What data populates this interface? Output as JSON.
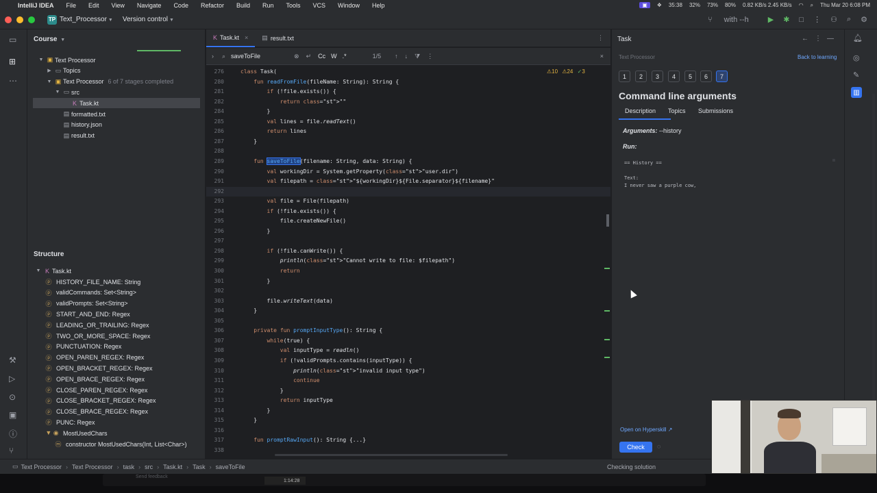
{
  "menubar": {
    "app": "IntelliJ IDEA",
    "items": [
      "File",
      "Edit",
      "View",
      "Navigate",
      "Code",
      "Refactor",
      "Build",
      "Run",
      "Tools",
      "VCS",
      "Window",
      "Help"
    ],
    "tray": [
      "35:38",
      "32%",
      "73%",
      "80%",
      "0.82 KB/s 2.45 KB/s"
    ],
    "datetime": "Thu Mar 20  6:08 PM"
  },
  "titlebar": {
    "project_badge": "TP",
    "project": "Text_Processor",
    "vcs": "Version control",
    "run_config": "with --h"
  },
  "course": {
    "title": "Course",
    "tree": [
      {
        "label": "Text Processor",
        "indent": 0,
        "icon": "course"
      },
      {
        "label": "Topics",
        "indent": 1,
        "icon": "folder"
      },
      {
        "label": "Text Processor",
        "indent": 1,
        "icon": "lesson",
        "extra": "6 of 7 stages completed"
      },
      {
        "label": "src",
        "indent": 2,
        "icon": "folder"
      },
      {
        "label": "Task.kt",
        "indent": 3,
        "icon": "kotlin",
        "selected": true
      },
      {
        "label": "formatted.txt",
        "indent": 2,
        "icon": "file"
      },
      {
        "label": "history.json",
        "indent": 2,
        "icon": "file"
      },
      {
        "label": "result.txt",
        "indent": 2,
        "icon": "file"
      }
    ]
  },
  "structure": {
    "title": "Structure",
    "root": "Task.kt",
    "items": [
      "HISTORY_FILE_NAME: String",
      "validCommands: Set<String>",
      "validPrompts: Set<String>",
      "START_AND_END: Regex",
      "LEADING_OR_TRAILING: Regex",
      "TWO_OR_MORE_SPACE: Regex",
      "PUNCTUATION: Regex",
      "OPEN_PAREN_REGEX: Regex",
      "OPEN_BRACKET_REGEX: Regex",
      "OPEN_BRACE_REGEX: Regex",
      "CLOSE_PAREN_REGEX: Regex",
      "CLOSE_BRACKET_REGEX: Regex",
      "CLOSE_BRACE_REGEX: Regex",
      "PUNC: Regex",
      "MostUsedChars",
      "constructor MostUsedChars(Int, List<Char>)"
    ]
  },
  "editor": {
    "tabs": [
      "Task.kt",
      "result.txt"
    ],
    "find": {
      "query": "saveToFile",
      "cc": "Cc",
      "w": "W",
      "regex": ".*",
      "count": "1/5"
    },
    "inspections": {
      "warn": "10",
      "weak": "24",
      "typo": "3"
    },
    "lines": [
      {
        "n": "276",
        "t": "class Task("
      },
      {
        "n": "280",
        "t": "    fun readFromFile(fileName: String): String {"
      },
      {
        "n": "281",
        "t": "        if (!file.exists()) {"
      },
      {
        "n": "282",
        "t": "            return \"\""
      },
      {
        "n": "284",
        "t": "        }"
      },
      {
        "n": "285",
        "t": "        val lines = file.readText()"
      },
      {
        "n": "286",
        "t": "        return lines"
      },
      {
        "n": "287",
        "t": "    }"
      },
      {
        "n": "288",
        "t": ""
      },
      {
        "n": "289",
        "t": "    fun saveToFile(filename: String, data: String) {"
      },
      {
        "n": "290",
        "t": "        val workingDir = System.getProperty(\"user.dir\")"
      },
      {
        "n": "291",
        "t": "        val filepath = \"${workingDir}${File.separator}${filename}\""
      },
      {
        "n": "292",
        "t": ""
      },
      {
        "n": "293",
        "t": "        val file = File(filepath)"
      },
      {
        "n": "294",
        "t": "        if (!file.exists()) {"
      },
      {
        "n": "295",
        "t": "            file.createNewFile()"
      },
      {
        "n": "296",
        "t": "        }"
      },
      {
        "n": "297",
        "t": ""
      },
      {
        "n": "298",
        "t": "        if (!file.canWrite()) {"
      },
      {
        "n": "299",
        "t": "            println(\"Cannot write to file: $filepath\")"
      },
      {
        "n": "300",
        "t": "            return"
      },
      {
        "n": "301",
        "t": "        }"
      },
      {
        "n": "302",
        "t": ""
      },
      {
        "n": "303",
        "t": "        file.writeText(data)"
      },
      {
        "n": "304",
        "t": "    }"
      },
      {
        "n": "305",
        "t": ""
      },
      {
        "n": "306",
        "t": "    private fun promptInputType(): String {"
      },
      {
        "n": "307",
        "t": "        while(true) {"
      },
      {
        "n": "308",
        "t": "            val inputType = readln()"
      },
      {
        "n": "309",
        "t": "            if (!validPrompts.contains(inputType)) {"
      },
      {
        "n": "310",
        "t": "                println(\"invalid input type\")"
      },
      {
        "n": "311",
        "t": "                continue"
      },
      {
        "n": "312",
        "t": "            }"
      },
      {
        "n": "313",
        "t": "            return inputType"
      },
      {
        "n": "314",
        "t": "        }"
      },
      {
        "n": "315",
        "t": "    }"
      },
      {
        "n": "316",
        "t": ""
      },
      {
        "n": "317",
        "t": "    fun promptRawInput(): String {...}"
      },
      {
        "n": "338",
        "t": ""
      }
    ]
  },
  "task": {
    "title": "Task",
    "breadcrumb": "Text Processor",
    "back": "Back to learning",
    "steps": [
      "1",
      "2",
      "3",
      "4",
      "5",
      "6",
      "7"
    ],
    "current_step": "7",
    "heading": "Command line arguments",
    "subtabs": [
      "Description",
      "Topics",
      "Submissions"
    ],
    "arguments_label": "Arguments:",
    "arguments_value": "--history",
    "run_label": "Run:",
    "output": "== History ==\n\nText:\nI never saw a purple cow,",
    "open_link": "Open on Hyperskill ↗",
    "check": "Check"
  },
  "status": {
    "breadcrumb": [
      "Text Processor",
      "Text Processor",
      "task",
      "src",
      "Task.kt",
      "Task",
      "saveToFile"
    ],
    "message": "Checking solution"
  },
  "dock": {
    "time": "1:14:28",
    "faded": "Send feedback"
  }
}
